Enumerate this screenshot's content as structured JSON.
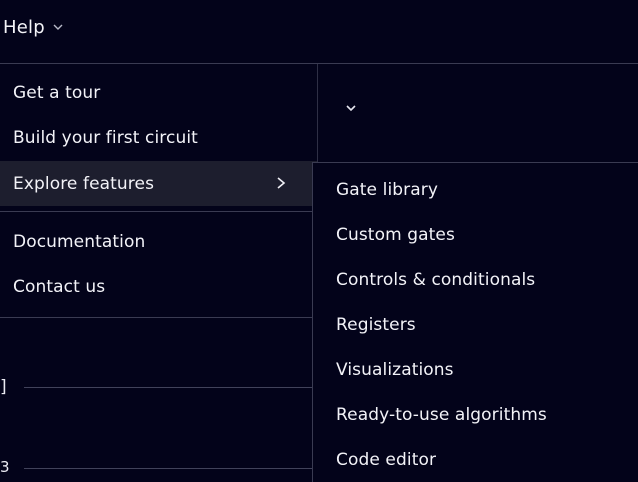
{
  "topbar": {
    "help_label": "Help",
    "help_icon": "chevron-down-icon"
  },
  "help_menu": {
    "items": [
      {
        "label": "Get a tour"
      },
      {
        "label": "Build your first circuit"
      },
      {
        "label": "Explore features",
        "icon": "chevron-right-icon",
        "active": true
      },
      {
        "label": "Documentation"
      },
      {
        "label": "Contact us"
      }
    ]
  },
  "explore_submenu": {
    "items": [
      {
        "label": "Gate library"
      },
      {
        "label": "Custom gates"
      },
      {
        "label": "Controls & conditionals"
      },
      {
        "label": "Registers"
      },
      {
        "label": "Visualizations"
      },
      {
        "label": "Ready-to-use algorithms"
      },
      {
        "label": "Code editor"
      }
    ]
  },
  "background": {
    "glyph_1": "]",
    "glyph_2": "3",
    "panel_icon": "chevron-down-icon"
  },
  "colors": {
    "background": "#03031a",
    "active_item": "#1d1e2e",
    "divider": "#3a3b52",
    "text": "#f3f3f8"
  }
}
